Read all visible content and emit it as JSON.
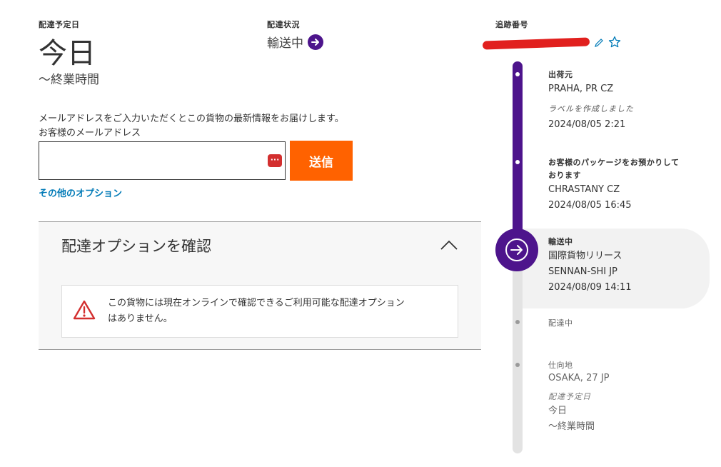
{
  "delivery": {
    "label": "配達予定日",
    "date": "今日",
    "time": "～終業時間"
  },
  "status": {
    "label": "配達状況",
    "value": "輸送中"
  },
  "tracking": {
    "label": "追跡番号"
  },
  "email": {
    "prompt": "メールアドレスをご入力いただくとこの貨物の最新情報をお届けします。",
    "field_label": "お客様のメールアドレス",
    "value": "",
    "send_label": "送信",
    "other_options": "その他のオプション"
  },
  "options_panel": {
    "title": "配達オプションを確認",
    "warning": [
      "この貨物には現在オンラインで確認できるご利用可能な配達オプション",
      "はありません。"
    ]
  },
  "timeline": {
    "events": [
      {
        "title": "出荷元",
        "location": "PRAHA, PR CZ",
        "note": "ラベルを作成しました",
        "datetime": "2024/08/05 2:21"
      },
      {
        "title_lines": [
          "お客様のパッケージをお預かりして",
          "おります"
        ],
        "location": "CHRASTANY CZ",
        "datetime": "2024/08/05 16:45"
      },
      {
        "title": "輸送中",
        "detail": "国際貨物リリース",
        "location": "SENNAN-SHI JP",
        "datetime": "2024/08/09 14:11"
      },
      {
        "title": "配達中"
      },
      {
        "title": "仕向地",
        "location": "OSAKA, 27 JP",
        "note": "配達予定日",
        "date": "今日",
        "time": "～終業時間"
      }
    ]
  },
  "colors": {
    "purple": "#4d148c",
    "orange": "#ff6200",
    "link": "#007ab7",
    "warning": "#d32f2f"
  }
}
